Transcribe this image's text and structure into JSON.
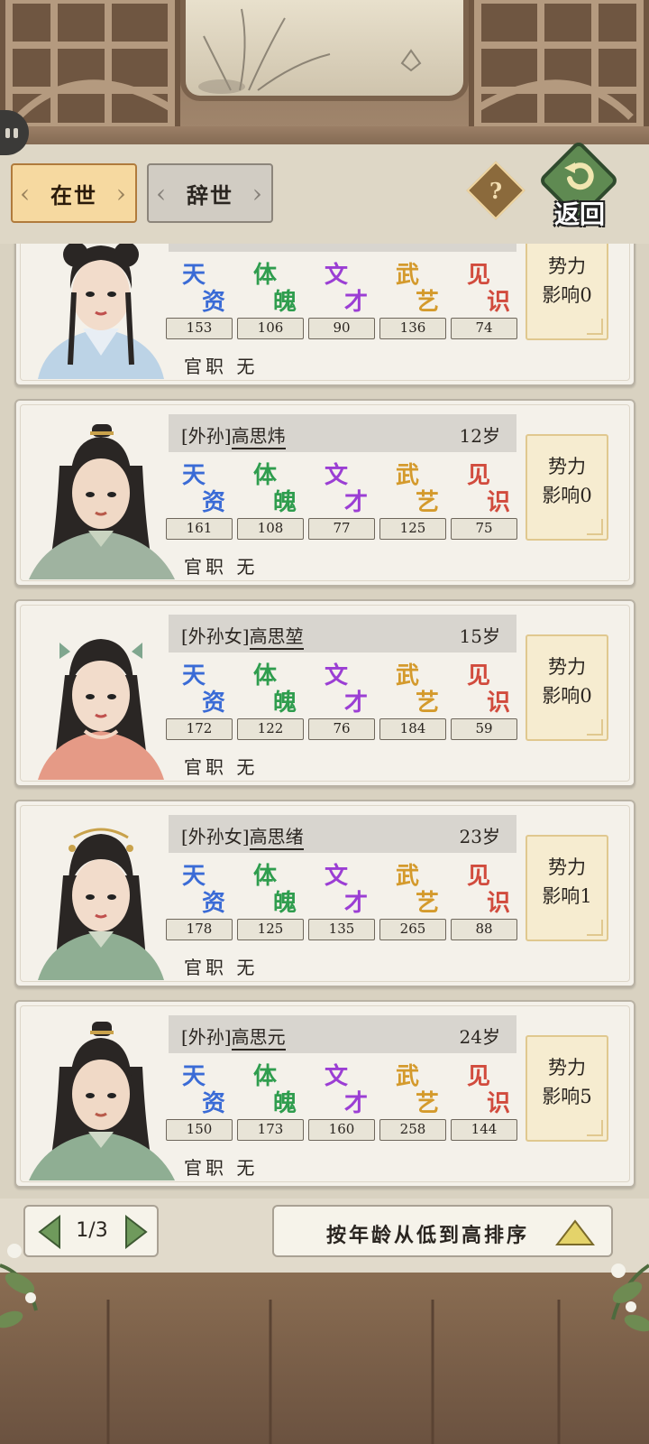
{
  "tabs": {
    "alive": "在世",
    "deceased": "辞世"
  },
  "help_icon": "?",
  "back_label": "返回",
  "attr_labels": [
    {
      "c1": "天",
      "c2": "资"
    },
    {
      "c1": "体",
      "c2": "魄"
    },
    {
      "c1": "文",
      "c2": "才"
    },
    {
      "c1": "武",
      "c2": "艺"
    },
    {
      "c1": "见",
      "c2": "识"
    }
  ],
  "power_label_1": "势力",
  "power_label_2": "影响",
  "office_label": "官职 无",
  "members": [
    {
      "relation": "",
      "name": "",
      "age": "",
      "stats": [
        "153",
        "106",
        "90",
        "136",
        "74"
      ],
      "power": "0"
    },
    {
      "relation": "[外孙]",
      "name": "高思炜",
      "age": "12岁",
      "stats": [
        "161",
        "108",
        "77",
        "125",
        "75"
      ],
      "power": "0"
    },
    {
      "relation": "[外孙女]",
      "name": "高思堃",
      "age": "15岁",
      "stats": [
        "172",
        "122",
        "76",
        "184",
        "59"
      ],
      "power": "0"
    },
    {
      "relation": "[外孙女]",
      "name": "高思绪",
      "age": "23岁",
      "stats": [
        "178",
        "125",
        "135",
        "265",
        "88"
      ],
      "power": "1"
    },
    {
      "relation": "[外孙]",
      "name": "高思元",
      "age": "24岁",
      "stats": [
        "150",
        "173",
        "160",
        "258",
        "144"
      ],
      "power": "5"
    }
  ],
  "pager": {
    "text": "1/3"
  },
  "sort": {
    "label": "按年龄从低到高排序"
  }
}
